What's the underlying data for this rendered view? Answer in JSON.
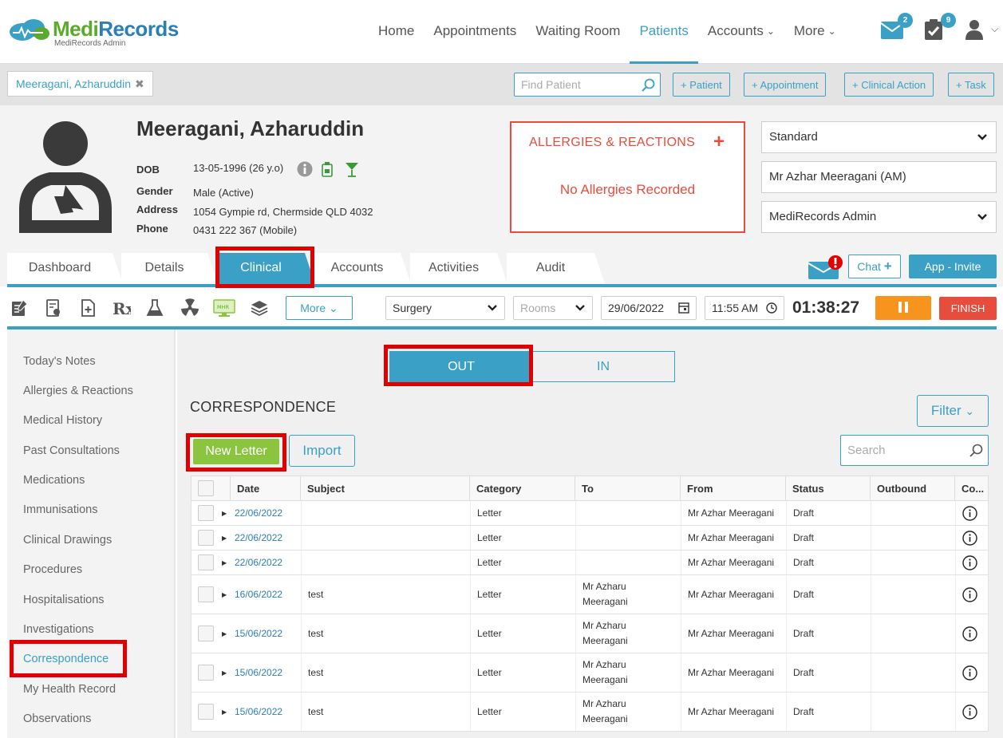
{
  "app": {
    "brand_medi": "Medi",
    "brand_records": "Records",
    "brand_sub": "MediRecords Admin"
  },
  "nav": {
    "items": [
      {
        "label": "Home",
        "active": false
      },
      {
        "label": "Appointments",
        "active": false
      },
      {
        "label": "Waiting Room",
        "active": false
      },
      {
        "label": "Patients",
        "active": true
      },
      {
        "label": "Accounts",
        "active": false,
        "dropdown": true
      },
      {
        "label": "More",
        "active": false,
        "dropdown": true
      }
    ],
    "mail_badge": "2",
    "tasks_badge": "9"
  },
  "patient_bar": {
    "open_tab": "Meeragani, Azharuddin",
    "find_placeholder": "Find Patient",
    "quick_buttons": [
      "+ Patient",
      "+ Appointment",
      "+ Clinical Action",
      "+ Task"
    ]
  },
  "patient": {
    "name": "Meeragani, Azharuddin",
    "dob_label": "DOB",
    "dob": "13-05-1996 (26 y.o)",
    "gender_label": "Gender",
    "gender": "Male (Active)",
    "address_label": "Address",
    "address": "1054 Gympie rd, Chermside QLD 4032",
    "phone_label": "Phone",
    "phone": "0431 222 367 (Mobile)"
  },
  "allergies": {
    "title": "ALLERGIES & REACTIONS",
    "empty": "No Allergies Recorded",
    "color": "#e74c3c"
  },
  "selectors": {
    "billing": "Standard",
    "doctor": "Mr Azhar Meeragani (AM)",
    "org": "MediRecords Admin"
  },
  "tabs": [
    {
      "label": "Dashboard",
      "active": false
    },
    {
      "label": "Details",
      "active": false
    },
    {
      "label": "Clinical",
      "active": true
    },
    {
      "label": "Accounts",
      "active": false
    },
    {
      "label": "Activities",
      "active": false
    },
    {
      "label": "Audit",
      "active": false
    }
  ],
  "tab_actions": {
    "chat": "Chat",
    "invite": "App - Invite"
  },
  "toolbar": {
    "more": "More",
    "location": "Surgery",
    "rooms_placeholder": "Rooms",
    "date": "29/06/2022",
    "time": "11:55 AM",
    "timer": "01:38:27",
    "finish": "FINISH",
    "mhr_label": "MHR"
  },
  "sidebar": {
    "items": [
      {
        "label": "Today's Notes",
        "active": false
      },
      {
        "label": "Allergies & Reactions",
        "active": false
      },
      {
        "label": "Medical History",
        "active": false
      },
      {
        "label": "Past Consultations",
        "active": false
      },
      {
        "label": "Medications",
        "active": false
      },
      {
        "label": "Immunisations",
        "active": false
      },
      {
        "label": "Clinical Drawings",
        "active": false
      },
      {
        "label": "Procedures",
        "active": false
      },
      {
        "label": "Hospitalisations",
        "active": false
      },
      {
        "label": "Investigations",
        "active": false
      },
      {
        "label": "Correspondence",
        "active": true
      },
      {
        "label": "My Health Record",
        "active": false
      },
      {
        "label": "Observations",
        "active": false
      }
    ]
  },
  "correspondence": {
    "toggle_out": "OUT",
    "toggle_in": "IN",
    "title": "CORRESPONDENCE",
    "filter": "Filter",
    "new_letter": "New Letter",
    "import": "Import",
    "search_placeholder": "Search",
    "columns": [
      "Date",
      "Subject",
      "Category",
      "To",
      "From",
      "Status",
      "Outbound",
      "Co..."
    ],
    "rows": [
      {
        "date": "22/06/2022",
        "subject": "",
        "category": "Letter",
        "to_line1": "",
        "to_line2": "",
        "from": "Mr Azhar Meeragani",
        "status": "Draft",
        "outbound": ""
      },
      {
        "date": "22/06/2022",
        "subject": "",
        "category": "Letter",
        "to_line1": "",
        "to_line2": "",
        "from": "Mr Azhar Meeragani",
        "status": "Draft",
        "outbound": ""
      },
      {
        "date": "22/06/2022",
        "subject": "",
        "category": "Letter",
        "to_line1": "",
        "to_line2": "",
        "from": "Mr Azhar Meeragani",
        "status": "Draft",
        "outbound": ""
      },
      {
        "date": "16/06/2022",
        "subject": "test",
        "category": "Letter",
        "to_line1": "Mr Azharu",
        "to_line2": "Meeragani",
        "from": "Mr Azhar Meeragani",
        "status": "Draft",
        "outbound": ""
      },
      {
        "date": "15/06/2022",
        "subject": "test",
        "category": "Letter",
        "to_line1": "Mr Azharu",
        "to_line2": "Meeragani",
        "from": "Mr Azhar Meeragani",
        "status": "Draft",
        "outbound": ""
      },
      {
        "date": "15/06/2022",
        "subject": "test",
        "category": "Letter",
        "to_line1": "Mr Azharu",
        "to_line2": "Meeragani",
        "from": "Mr Azhar Meeragani",
        "status": "Draft",
        "outbound": ""
      },
      {
        "date": "15/06/2022",
        "subject": "test",
        "category": "Letter",
        "to_line1": "Mr Azharu",
        "to_line2": "Meeragani",
        "from": "Mr Azhar Meeragani",
        "status": "Draft",
        "outbound": ""
      }
    ]
  },
  "colors": {
    "accent": "#3aa0c6",
    "brand_green": "#5aaa2e",
    "new_letter_green": "#8bc53f",
    "pause_orange": "#f7941d",
    "finish_red": "#e74c3c",
    "highlight_red": "#e00000"
  }
}
